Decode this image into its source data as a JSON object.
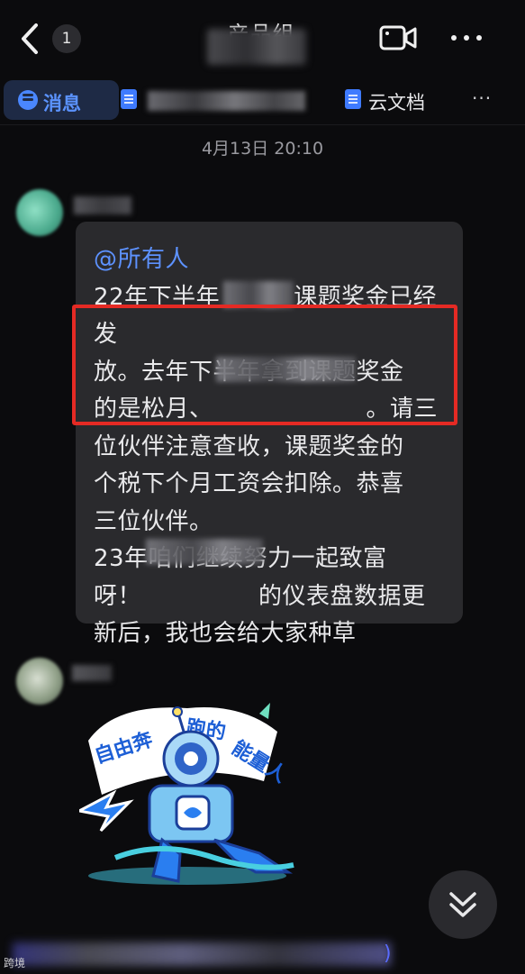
{
  "header": {
    "unread_count": "1",
    "title": "产品组"
  },
  "tabs": {
    "messages_label": "消息",
    "doc2_label": "云文档",
    "more_label": "···"
  },
  "timestamp": "4月13日 20:10",
  "message": {
    "mention": "@所有人",
    "lines": [
      "22年下半年",
      "课题奖金已经发",
      "放。去年下半年拿到课题奖金",
      "的是松月、",
      "。请三",
      "位伙伴注意查收，课题奖金的",
      "个税下个月工资会扣除。恭喜",
      "三位伙伴。",
      "23年咱们继续努力一起致富",
      "呀！",
      "的仪表盘数据更",
      "新后，我也会给大家种草"
    ]
  },
  "sticker": {
    "text": "自由奔跑的能量人"
  },
  "bottom": {
    "paren": ")",
    "watermark": "跨境"
  },
  "colors": {
    "accent": "#5b93ff",
    "highlight_border": "#e52a24",
    "bubble_bg": "#2a2a2d"
  }
}
